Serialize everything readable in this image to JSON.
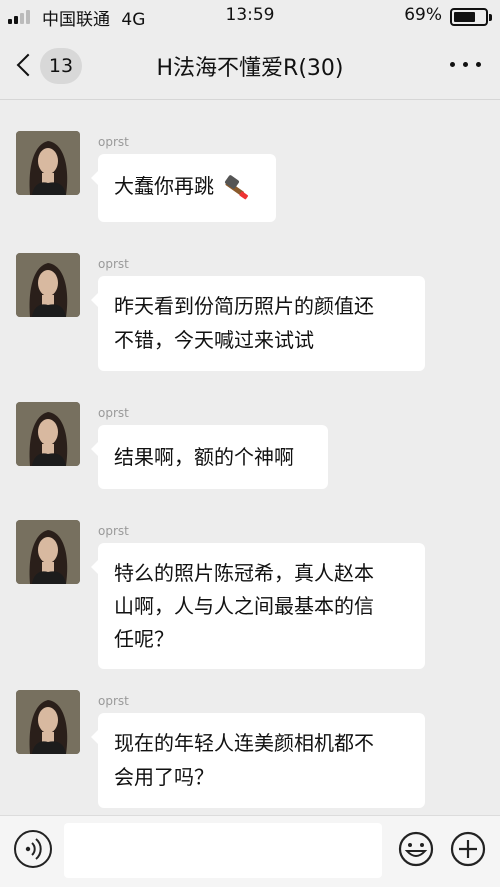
{
  "status_bar": {
    "carrier": "中国联通",
    "network": "4G",
    "time": "13:59",
    "battery_text": "69%",
    "battery_level": 0.69
  },
  "nav": {
    "unread_count": "13",
    "title": "H法海不懂爱R(30)",
    "back_icon": "chevron-left-icon",
    "more_icon": "more-dots-icon"
  },
  "messages": [
    {
      "sender": "oprst",
      "text": "大蠢你再跳",
      "sticker": "hammer-icon"
    },
    {
      "sender": "oprst",
      "text_lines": [
        "昨天看到份简历照片的颜值还",
        "不错，今天喊过来试试"
      ]
    },
    {
      "sender": "oprst",
      "text": "结果啊，额的个神啊"
    },
    {
      "sender": "oprst",
      "text_lines": [
        "特么的照片陈冠希，真人赵本",
        "山啊，人与人之间最基本的信",
        "任呢？"
      ]
    },
    {
      "sender": "oprst",
      "text_lines": [
        "现在的年轻人连美颜相机都不",
        "会用了吗？"
      ]
    }
  ],
  "input_bar": {
    "voice_icon": "voice-icon",
    "emoji_icon": "emoji-icon",
    "plus_icon": "plus-icon",
    "input_value": "",
    "placeholder": ""
  },
  "colors": {
    "background": "#ededed",
    "bubble": "#ffffff",
    "sender_name": "#9a9a9a"
  }
}
